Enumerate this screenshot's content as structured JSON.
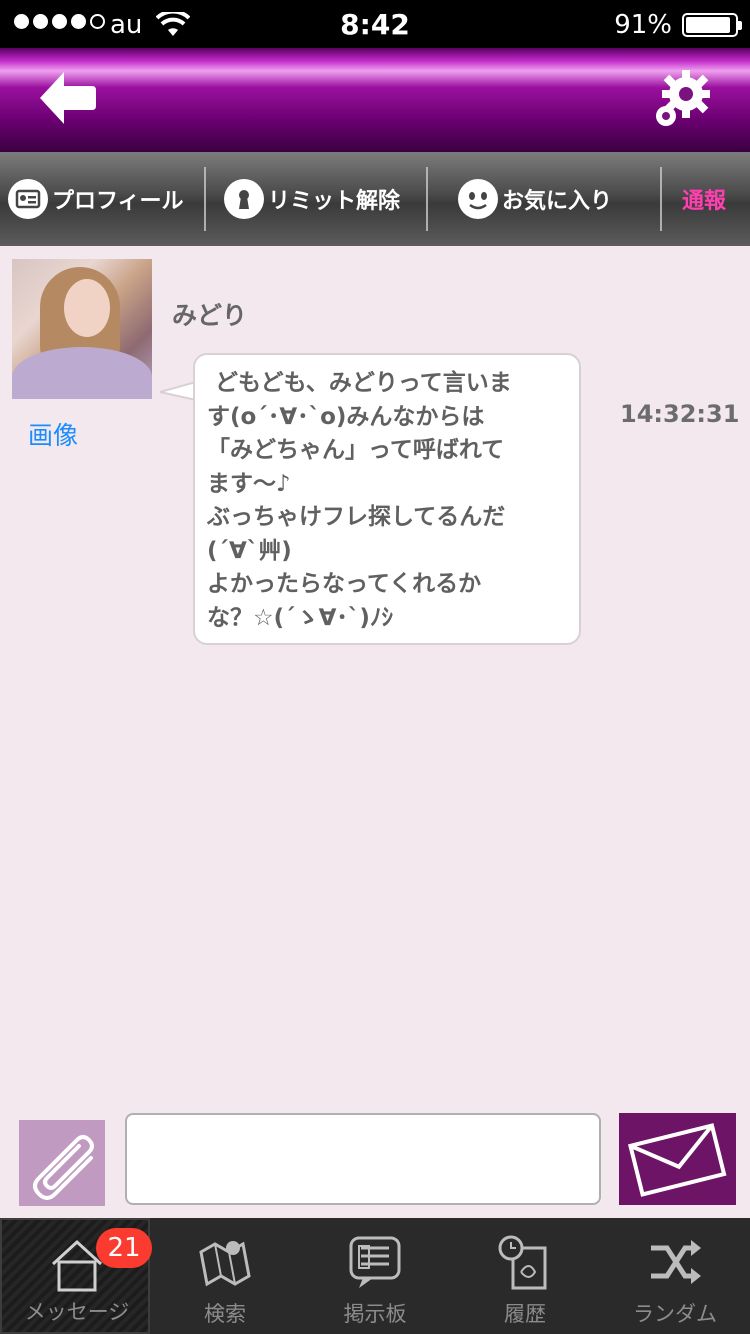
{
  "status_bar": {
    "carrier": "au",
    "time": "8:42",
    "battery": "91%",
    "battery_level": 0.91,
    "signal_bars": 4
  },
  "header": {
    "back_icon": "back-arrow-icon",
    "settings_icon": "gear-icon",
    "colors": {
      "brand": "#8a0a90"
    }
  },
  "toolbar": {
    "profile": "プロフィール",
    "limit_release": "リミット解除",
    "favorite": "お気に入り",
    "report": "通報",
    "report_color": "#ff3fb0"
  },
  "chat": {
    "sender_name": "みどり",
    "image_link": "画像",
    "message": " どもども、みどりって言いま\nす(o´･∀･`o)みんなからは\n「みどちゃん」って呼ばれて\nます〜♪\nぶっちゃけフレ探してるんだ\n(´∀`艸)\nよかったらなってくれるか\nな？☆(´ゝ∀･`)ﾉｼ",
    "timestamp": "14:32:31"
  },
  "composer": {
    "input_value": "",
    "attach_icon": "paperclip-icon",
    "send_icon": "envelope-icon"
  },
  "tabbar": {
    "tabs": [
      {
        "label": "メッセージ",
        "icon": "home-icon",
        "badge": "21",
        "active": true
      },
      {
        "label": "検索",
        "icon": "map-search-icon"
      },
      {
        "label": "掲示板",
        "icon": "bulletin-board-icon"
      },
      {
        "label": "履歴",
        "icon": "history-icon"
      },
      {
        "label": "ランダム",
        "icon": "shuffle-icon"
      }
    ]
  }
}
